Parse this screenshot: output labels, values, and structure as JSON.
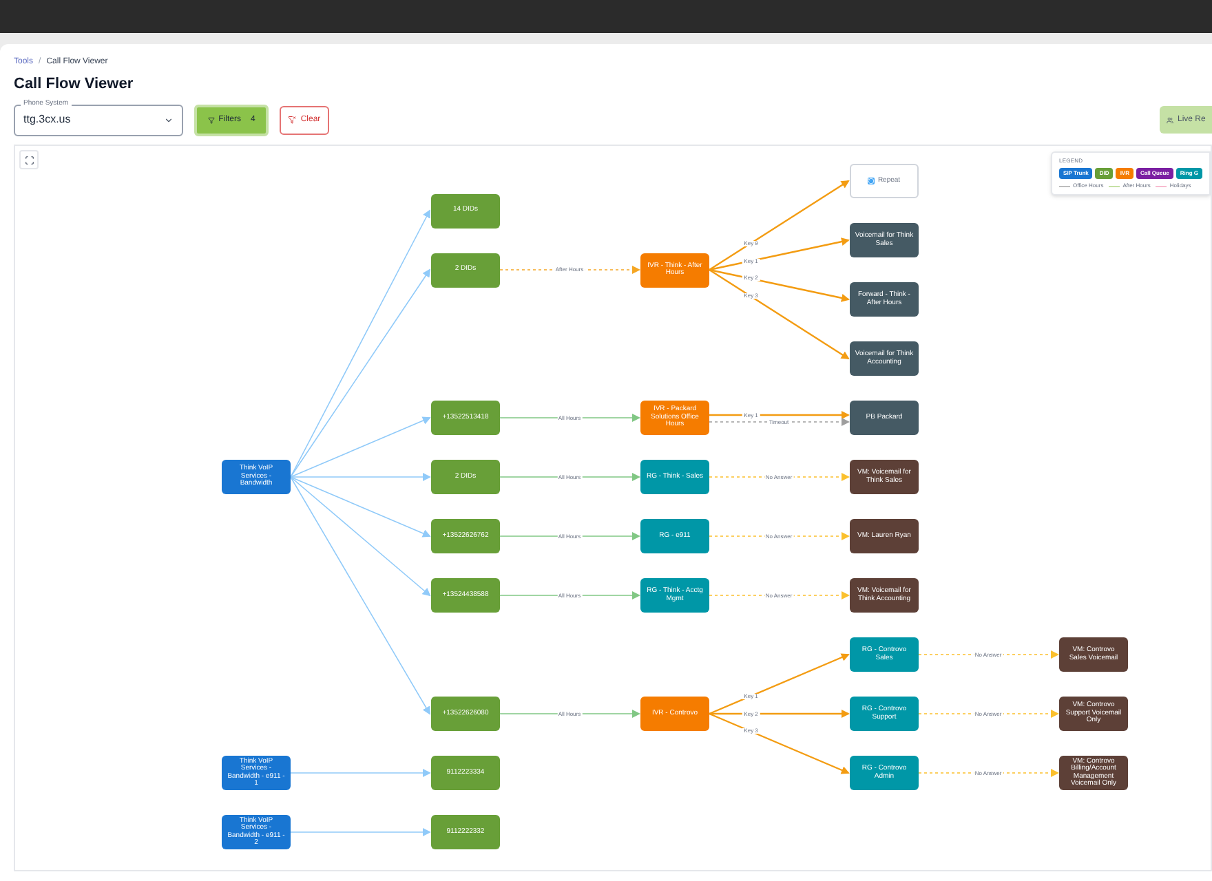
{
  "breadcrumb": [
    {
      "label": "Tools",
      "link": true
    },
    {
      "label": "Call Flow Viewer",
      "link": false
    }
  ],
  "breadcrumb_separator": "/",
  "title": "Call Flow Viewer",
  "phone_system": {
    "label": "Phone System",
    "value": "ttg.3cx.us"
  },
  "filters_button": {
    "label": "Filters",
    "count": "4"
  },
  "clear_button": {
    "label": "Clear"
  },
  "live_button": {
    "label": "Live Re"
  },
  "legend": {
    "title": "LEGEND",
    "node_types": [
      {
        "label": "SIP Trunk",
        "color": "#1976d2"
      },
      {
        "label": "DID",
        "color": "#689f38"
      },
      {
        "label": "IVR",
        "color": "#f57c00"
      },
      {
        "label": "Call Queue",
        "color": "#7b1fa2"
      },
      {
        "label": "Ring G",
        "color": "#0097a7"
      }
    ],
    "line_types": [
      {
        "label": "Office Hours",
        "color": "#bdbdbd"
      },
      {
        "label": "After Hours",
        "color": "#c5e1a5"
      },
      {
        "label": "Holidays",
        "color": "#f8bbd0"
      }
    ]
  },
  "flow": [
    {
      "label": "Think VoIP Services - Bandwidth",
      "kind": "sip_trunk",
      "children": [
        {
          "label": "14 DIDs",
          "kind": "did",
          "edges": [
            {
              "kind": "trunk"
            }
          ]
        },
        {
          "label": "2 DIDs",
          "kind": "did",
          "edges": [
            {
              "kind": "trunk"
            }
          ],
          "children": [
            {
              "label": "IVR - Think - After Hours",
              "kind": "ivr",
              "edges": [
                {
                  "kind": "after_hours",
                  "label": "After Hours"
                }
              ],
              "children": [
                {
                  "label": "Repeat",
                  "kind": "repeat",
                  "edges": [
                    {
                      "kind": "key",
                      "label": "Key 9"
                    }
                  ]
                },
                {
                  "label": "Voicemail for Think Sales",
                  "kind": "action",
                  "edges": [
                    {
                      "kind": "key",
                      "label": "Key 1"
                    }
                  ]
                },
                {
                  "label": "Forward - Think - After Hours",
                  "kind": "action",
                  "edges": [
                    {
                      "kind": "key",
                      "label": "Key 2"
                    }
                  ]
                },
                {
                  "label": "Voicemail for Think Accounting",
                  "kind": "action",
                  "edges": [
                    {
                      "kind": "key",
                      "label": "Key 3"
                    }
                  ]
                }
              ]
            }
          ]
        },
        {
          "label": "+13522513418",
          "kind": "did",
          "edges": [
            {
              "kind": "trunk"
            }
          ],
          "children": [
            {
              "label": "IVR - Packard Solutions Office Hours",
              "kind": "ivr",
              "edges": [
                {
                  "kind": "all_hours",
                  "label": "All Hours"
                }
              ],
              "children": [
                {
                  "label": "PB Packard",
                  "kind": "action",
                  "edges": [
                    {
                      "kind": "key",
                      "label": "Key 1"
                    },
                    {
                      "kind": "timeout",
                      "label": "Timeout"
                    }
                  ]
                }
              ]
            }
          ]
        },
        {
          "label": "2 DIDs",
          "kind": "did",
          "edges": [
            {
              "kind": "trunk"
            }
          ],
          "children": [
            {
              "label": "RG - Think - Sales",
              "kind": "ring_group",
              "edges": [
                {
                  "kind": "all_hours",
                  "label": "All Hours"
                }
              ],
              "children": [
                {
                  "label": "VM: Voicemail for Think Sales",
                  "kind": "voicemail",
                  "edges": [
                    {
                      "kind": "no_answer",
                      "label": "No Answer"
                    }
                  ]
                }
              ]
            }
          ]
        },
        {
          "label": "+13522626762",
          "kind": "did",
          "edges": [
            {
              "kind": "trunk"
            }
          ],
          "children": [
            {
              "label": "RG - e911",
              "kind": "ring_group",
              "edges": [
                {
                  "kind": "all_hours",
                  "label": "All Hours"
                }
              ],
              "children": [
                {
                  "label": "VM: Lauren Ryan",
                  "kind": "voicemail",
                  "edges": [
                    {
                      "kind": "no_answer",
                      "label": "No Answer"
                    }
                  ]
                }
              ]
            }
          ]
        },
        {
          "label": "+13524438588",
          "kind": "did",
          "edges": [
            {
              "kind": "trunk"
            }
          ],
          "children": [
            {
              "label": "RG - Think - Acctg Mgmt",
              "kind": "ring_group",
              "edges": [
                {
                  "kind": "all_hours",
                  "label": "All Hours"
                }
              ],
              "children": [
                {
                  "label": "VM: Voicemail for Think Accounting",
                  "kind": "voicemail",
                  "edges": [
                    {
                      "kind": "no_answer",
                      "label": "No Answer"
                    }
                  ]
                }
              ]
            }
          ]
        },
        {
          "label": "+13522626080",
          "kind": "did",
          "edges": [
            {
              "kind": "trunk"
            }
          ],
          "children": [
            {
              "label": "IVR - Controvo",
              "kind": "ivr",
              "edges": [
                {
                  "kind": "all_hours",
                  "label": "All Hours"
                }
              ],
              "children": [
                {
                  "label": "RG - Controvo Sales",
                  "kind": "ring_group",
                  "edges": [
                    {
                      "kind": "key",
                      "label": "Key 1"
                    }
                  ],
                  "children": [
                    {
                      "label": "VM: Controvo Sales Voicemail",
                      "kind": "voicemail",
                      "edges": [
                        {
                          "kind": "no_answer",
                          "label": "No Answer"
                        }
                      ]
                    }
                  ]
                },
                {
                  "label": "RG - Controvo Support",
                  "kind": "ring_group",
                  "edges": [
                    {
                      "kind": "key",
                      "label": "Key 2"
                    }
                  ],
                  "children": [
                    {
                      "label": "VM: Controvo Support Voicemail Only",
                      "kind": "voicemail",
                      "edges": [
                        {
                          "kind": "no_answer",
                          "label": "No Answer"
                        }
                      ]
                    }
                  ]
                },
                {
                  "label": "RG - Controvo Admin",
                  "kind": "ring_group",
                  "edges": [
                    {
                      "kind": "key",
                      "label": "Key 3"
                    }
                  ],
                  "children": [
                    {
                      "label": "VM: Controvo Billing/Account Management Voicemail Only",
                      "kind": "voicemail",
                      "edges": [
                        {
                          "kind": "no_answer",
                          "label": "No Answer"
                        }
                      ]
                    }
                  ]
                }
              ]
            }
          ]
        }
      ]
    },
    {
      "label": "Think VoIP Services - Bandwidth - e911 - 1",
      "kind": "sip_trunk",
      "children": [
        {
          "label": "9112223334",
          "kind": "did",
          "edges": [
            {
              "kind": "trunk"
            }
          ]
        }
      ]
    },
    {
      "label": "Think VoIP Services - Bandwidth - e911 - 2",
      "kind": "sip_trunk",
      "children": [
        {
          "label": "9112222332",
          "kind": "did",
          "edges": [
            {
              "kind": "trunk"
            }
          ]
        }
      ]
    }
  ]
}
